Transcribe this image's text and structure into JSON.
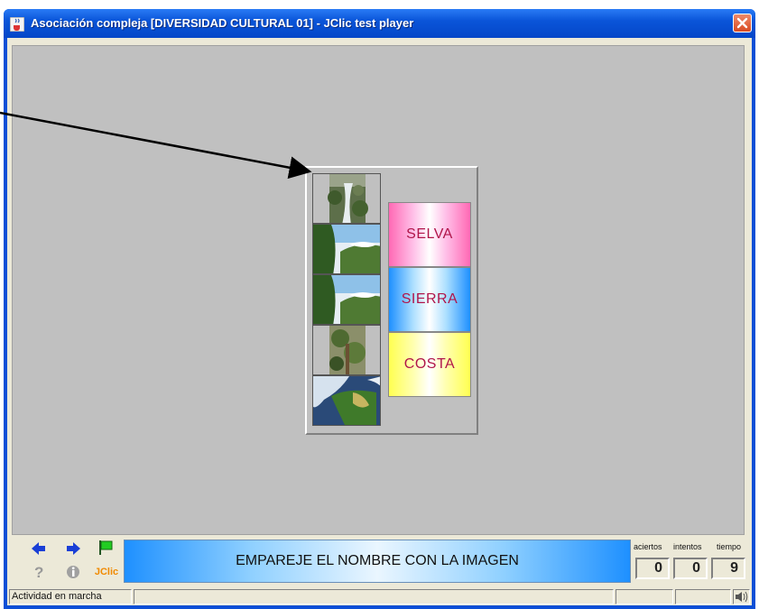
{
  "window": {
    "title": "Asociación compleja [DIVERSIDAD CULTURAL 01] - JClic test player"
  },
  "activity": {
    "images": [
      {
        "name": "waterfall-forest-image"
      },
      {
        "name": "mountain-valley-image"
      },
      {
        "name": "mountain-valley-image-2"
      },
      {
        "name": "forest-trees-image"
      },
      {
        "name": "peru-map-image"
      }
    ],
    "words": [
      {
        "label": "SELVA",
        "color": "#ff69b4"
      },
      {
        "label": "SIERRA",
        "color": "#1e90ff"
      },
      {
        "label": "COSTA",
        "color": "#ffff50"
      }
    ]
  },
  "toolbar": {
    "prev_icon": "arrow-left-icon",
    "next_icon": "arrow-right-icon",
    "reset_icon": "green-flag-icon",
    "help_icon": "question-icon",
    "info_icon": "info-icon",
    "jclic_label": "JClic"
  },
  "message": "EMPAREJE EL NOMBRE CON LA IMAGEN",
  "counters": {
    "labels": [
      "aciertos",
      "intentos",
      "tiempo"
    ],
    "values": [
      "0",
      "0",
      "9"
    ]
  },
  "status": {
    "text": "Actividad en marcha",
    "sound_icon": "speaker-icon"
  }
}
